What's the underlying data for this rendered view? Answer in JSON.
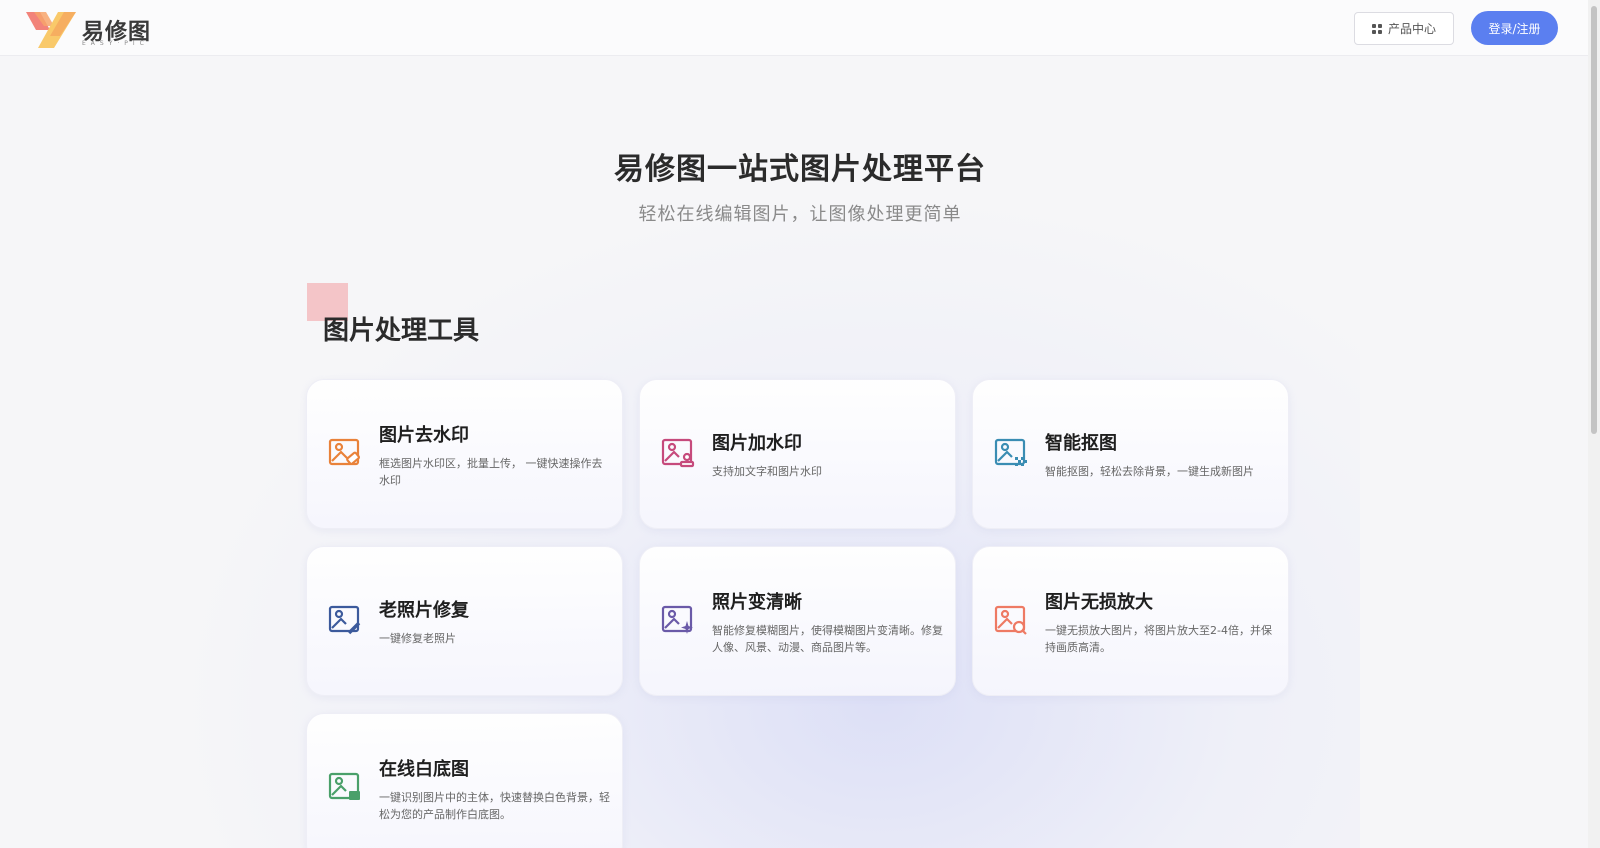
{
  "header": {
    "logo_text": "易修图",
    "logo_sub": "EASY·PIC",
    "products_label": "产品中心",
    "login_label": "登录/注册"
  },
  "hero": {
    "title": "易修图一站式图片处理平台",
    "subtitle": "轻松在线编辑图片，让图像处理更简单"
  },
  "section": {
    "title": "图片处理工具"
  },
  "cards": [
    {
      "title": "图片去水印",
      "desc": "框选图片水印区，批量上传， 一键快速操作去水印",
      "icon": "image-eraser-icon",
      "color": "#e9823a"
    },
    {
      "title": "图片加水印",
      "desc": "支持加文字和图片水印",
      "icon": "image-stamp-icon",
      "color": "#c64a7c"
    },
    {
      "title": "智能抠图",
      "desc": "智能抠图，轻松去除背景，一键生成新图片",
      "icon": "image-cutout-icon",
      "color": "#3a8db3"
    },
    {
      "title": "老照片修复",
      "desc": "一键修复老照片",
      "icon": "image-repair-icon",
      "color": "#3c5a9c"
    },
    {
      "title": "照片变清晰",
      "desc": "智能修复模糊图片，使得模糊图片变清晰。修复人像、风景、动漫、商品图片等。",
      "icon": "image-sparkle-icon",
      "color": "#6a5aa8"
    },
    {
      "title": "图片无损放大",
      "desc": "一键无损放大图片，将图片放大至2-4倍，并保持画质高清。",
      "icon": "image-zoom-icon",
      "color": "#ee7a64"
    },
    {
      "title": "在线白底图",
      "desc": "一键识别图片中的主体，快速替换白色背景，轻松为您的产品制作白底图。",
      "icon": "image-whitebg-icon",
      "color": "#4aa06a"
    }
  ]
}
